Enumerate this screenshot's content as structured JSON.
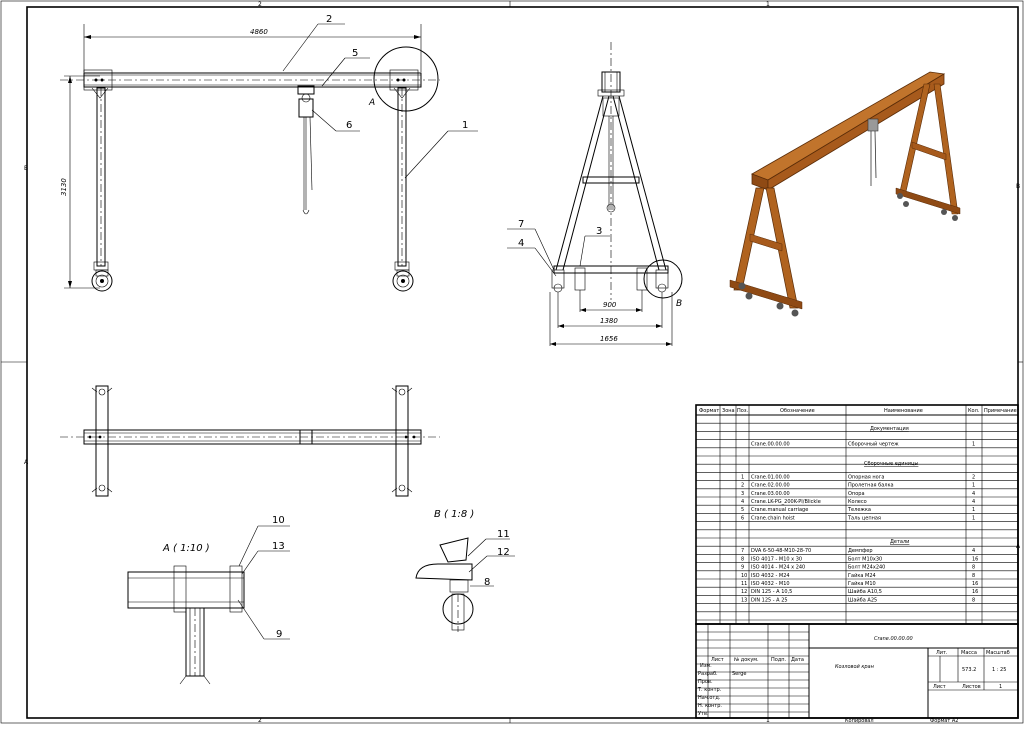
{
  "zones": {
    "top": [
      "2",
      "1"
    ],
    "left": [
      "B",
      "A"
    ],
    "right": [
      "B",
      "A"
    ],
    "bottom": [
      "2",
      "1"
    ]
  },
  "front_view": {
    "dim_width": "4860",
    "dim_height": "3130",
    "callouts": [
      "2",
      "5",
      "6",
      "1"
    ],
    "detail_label": "A"
  },
  "side_view": {
    "dims": [
      "900",
      "1380",
      "1656"
    ],
    "callouts": [
      "7",
      "4",
      "3"
    ],
    "detail_label": "B"
  },
  "detail_a": {
    "title": "A ( 1:10 )",
    "callouts": [
      "10",
      "13",
      "9"
    ]
  },
  "detail_b": {
    "title": "B ( 1:8 )",
    "callouts": [
      "11",
      "12",
      "8"
    ]
  },
  "spec": {
    "headers": [
      "Формат",
      "Зона",
      "Поз.",
      "Обозначение",
      "Наименование",
      "Кол.",
      "Примечание"
    ],
    "sections": {
      "documentation": "Документация",
      "assemblies": "Сборочные единицы",
      "details": "Детали"
    },
    "doc_rows": [
      {
        "pos": "",
        "designation": "Crane.00.00.00",
        "name": "Сборочный чертеж",
        "qty": "1"
      }
    ],
    "assembly_rows": [
      {
        "pos": "1",
        "designation": "Crane.01.00.00",
        "name": "Опорная нога",
        "qty": "2"
      },
      {
        "pos": "2",
        "designation": "Crane.02.00.00",
        "name": "Пролетная балка",
        "qty": "1"
      },
      {
        "pos": "3",
        "designation": "Crane.03.00.00",
        "name": "Опора",
        "qty": "4"
      },
      {
        "pos": "4",
        "designation": "Crane.LK-PG_200K-PI/Blickle",
        "name": "Колесо",
        "qty": "4"
      },
      {
        "pos": "5",
        "designation": "Crane.manual carriage",
        "name": "Тележка",
        "qty": "1"
      },
      {
        "pos": "6",
        "designation": "Crane.chain hoist",
        "name": "Таль цепная",
        "qty": "1"
      }
    ],
    "detail_rows": [
      {
        "pos": "7",
        "designation": "DVA 6-50-48-M10-28-70",
        "name": "Демпфер",
        "qty": "4"
      },
      {
        "pos": "8",
        "designation": "ISO 4017 - M10 x 30",
        "name": "Болт M10x30",
        "qty": "16"
      },
      {
        "pos": "9",
        "designation": "ISO 4014 - M24 x 240",
        "name": "Болт M24x240",
        "qty": "8"
      },
      {
        "pos": "10",
        "designation": "ISO 4032 - M24",
        "name": "Гайка M24",
        "qty": "8"
      },
      {
        "pos": "11",
        "designation": "ISO 4032 - M10",
        "name": "Гайка M10",
        "qty": "16"
      },
      {
        "pos": "12",
        "designation": "DIN 125 - A 10,5",
        "name": "Шайба A10,5",
        "qty": "16"
      },
      {
        "pos": "13",
        "designation": "DIN 125 - A 25",
        "name": "Шайба A25",
        "qty": "8"
      }
    ]
  },
  "title_block": {
    "doc_number": "Crane.00.00.00",
    "product_name": "Козловой кран",
    "lit_label": "Лит.",
    "mass_label": "Масса",
    "scale_label": "Масштаб",
    "mass": "573.2",
    "scale": "1 : 25",
    "sheet_label": "Лист",
    "sheets_label": "Листов",
    "sheets_value": "1",
    "row_labels": [
      "Изм.",
      "Лист",
      "№ докум.",
      "Подп.",
      "Дата"
    ],
    "roles": [
      "Разраб.",
      "Пров.",
      "Т. контр.",
      "Нач.отд.",
      "Н. контр.",
      "Утв."
    ],
    "developer": "Serge",
    "copied": "Копировал",
    "format": "Формат A2"
  },
  "colors": {
    "wood": "#b0631f",
    "wood_dark": "#7a3c0e",
    "line": "#000000"
  }
}
